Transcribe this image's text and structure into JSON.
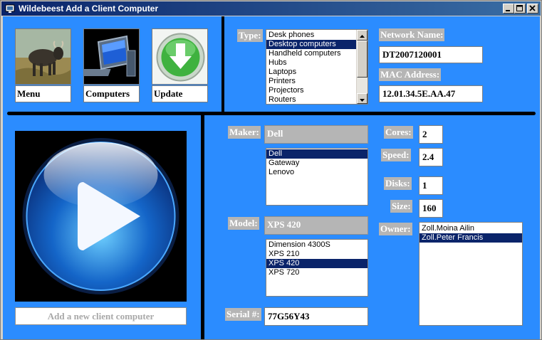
{
  "window": {
    "title": "Wildebeest Add a Client Computer"
  },
  "nav": {
    "menu_label": "Menu",
    "computers_label": "Computers",
    "update_label": "Update"
  },
  "type": {
    "label": "Type:",
    "items": [
      "Desk phones",
      "Desktop computers",
      "Handheld computers",
      "Hubs",
      "Laptops",
      "Printers",
      "Projectors",
      "Routers"
    ],
    "selected": "Desktop computers"
  },
  "network": {
    "name_label": "Network Name:",
    "name_value": "DT2007120001",
    "mac_label": "MAC Address:",
    "mac_value": "12.01.34.5E.AA.47"
  },
  "maker": {
    "label": "Maker:",
    "value": "Dell",
    "items": [
      "Dell",
      "Gateway",
      "Lenovo"
    ],
    "selected": "Dell"
  },
  "model": {
    "label": "Model:",
    "value": "XPS 420",
    "items": [
      "Dimension 4300S",
      "XPS 210",
      "XPS 420",
      "XPS 720"
    ],
    "selected": "XPS 420"
  },
  "serial": {
    "label": "Serial #:",
    "value": "77G56Y43"
  },
  "specs": {
    "cores_label": "Cores:",
    "cores_value": "2",
    "speed_label": "Speed:",
    "speed_value": "2.4",
    "disks_label": "Disks:",
    "disks_value": "1",
    "size_label": "Size:",
    "size_value": "160"
  },
  "owner": {
    "label": "Owner:",
    "items": [
      "Zoll.Moina Ailin",
      "Zoll.Peter Francis"
    ],
    "selected": "Zoll.Peter Francis"
  },
  "action": {
    "add_label": "Add a new client computer"
  },
  "colors": {
    "background": "#2b8cff",
    "selection": "#0a246a",
    "label_bg": "#b5b5b5"
  }
}
